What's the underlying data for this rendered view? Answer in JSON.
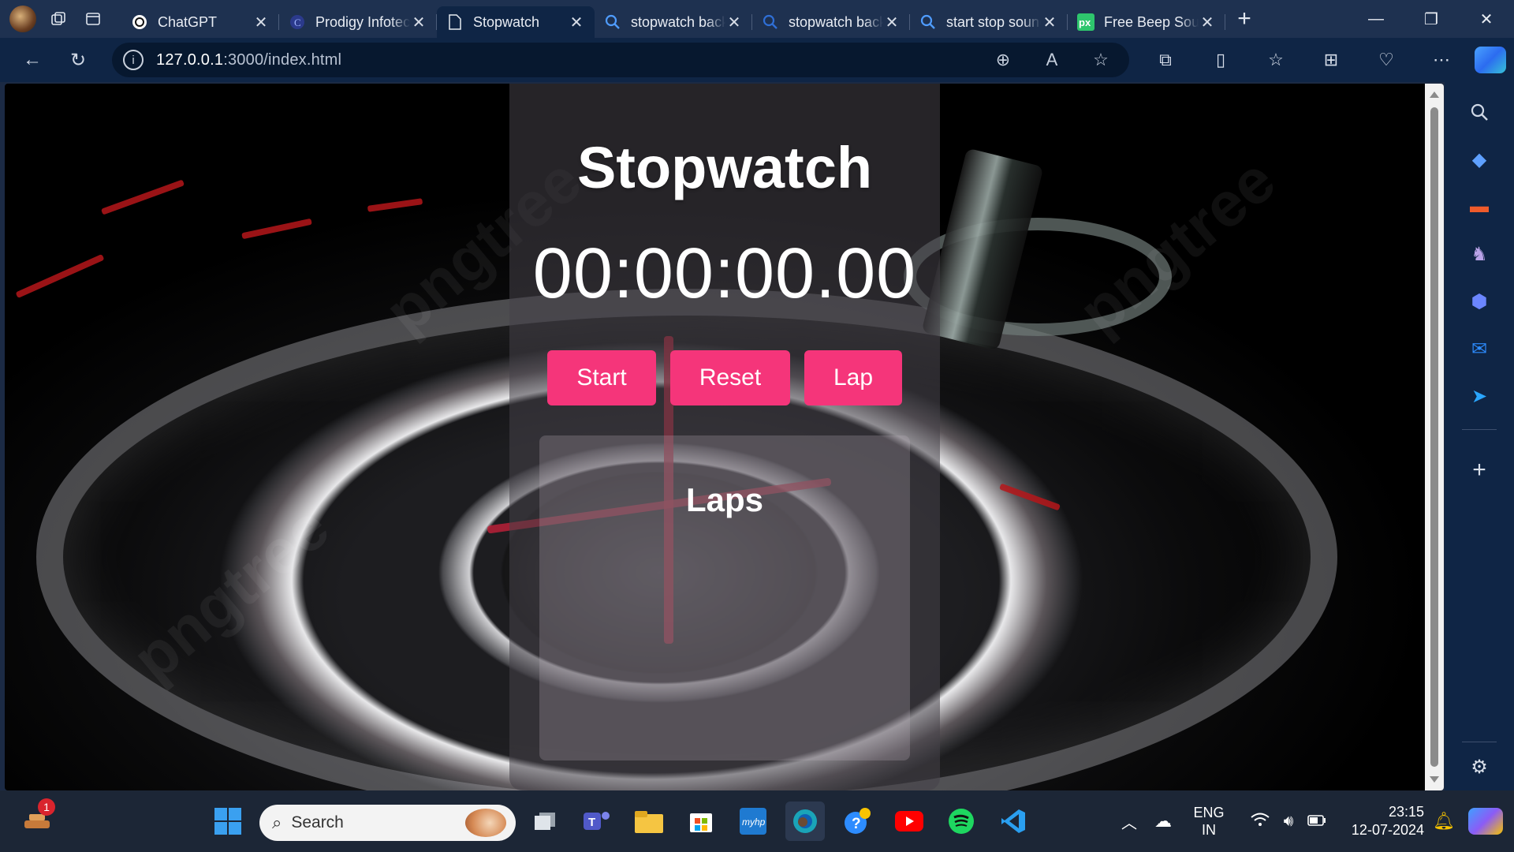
{
  "browser": {
    "tabs": [
      {
        "title": "ChatGPT",
        "icon": "chatgpt-icon"
      },
      {
        "title": "Prodigy Infotech",
        "icon": "prodigy-icon"
      },
      {
        "title": "Stopwatch",
        "icon": "page-icon",
        "active": true
      },
      {
        "title": "stopwatch background",
        "icon": "search-icon"
      },
      {
        "title": "stopwatch background",
        "icon": "search-icon"
      },
      {
        "title": "start stop sound",
        "icon": "search-icon"
      },
      {
        "title": "Free Beep Sound",
        "icon": "pixabay-icon"
      }
    ],
    "url_host": "127.0.0.1",
    "url_path": ":3000/index.html"
  },
  "page": {
    "title": "Stopwatch",
    "time": "00:00:00.00",
    "buttons": {
      "start": "Start",
      "reset": "Reset",
      "lap": "Lap"
    },
    "laps_heading": "Laps"
  },
  "taskbar": {
    "search_placeholder": "Search",
    "notification_count": "1",
    "language": "ENG",
    "region": "IN",
    "time": "23:15",
    "date": "12-07-2024"
  },
  "colors": {
    "accent_button": "#f5357a",
    "browser_chrome": "#0f2545"
  }
}
